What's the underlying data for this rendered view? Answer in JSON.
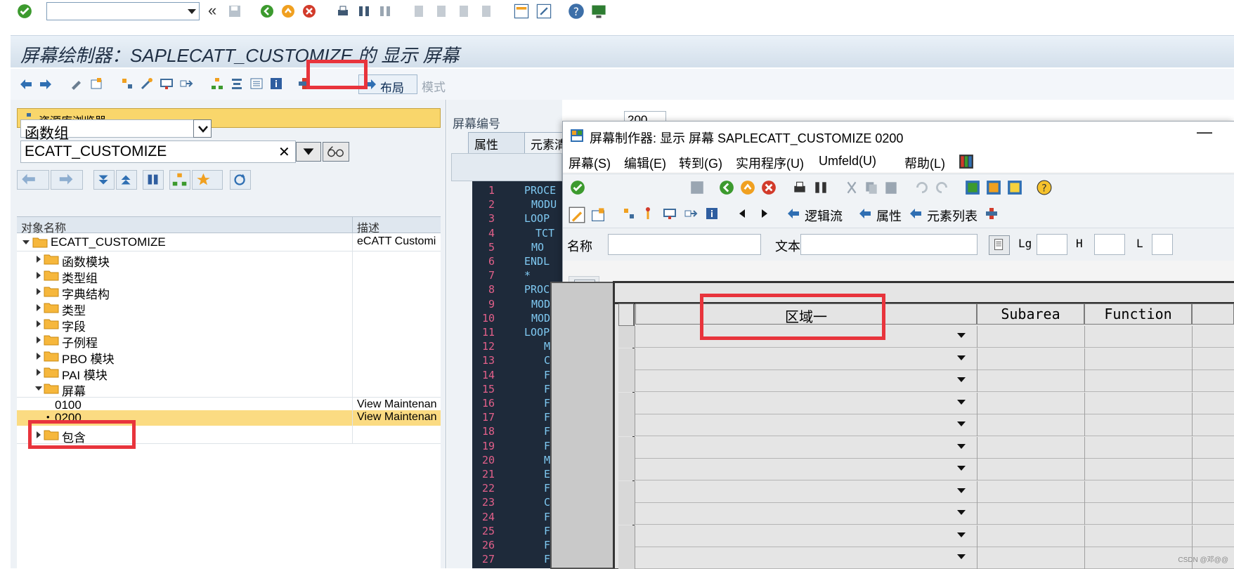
{
  "window": {
    "title": "屏幕绘制器：SAPLECATT_CUSTOMIZE 的 显示 屏幕"
  },
  "app_toolbar": {
    "layout_label": "布局",
    "mode_label": "模式"
  },
  "repository": {
    "header": "资源库浏览器",
    "object_type": "函数组",
    "object_name": "ECATT_CUSTOMIZE",
    "close_symbol": "✕"
  },
  "tree": {
    "col_object": "对象名称",
    "col_desc": "描述",
    "root": {
      "name": "ECATT_CUSTOMIZE",
      "desc": "eCATT Customi"
    },
    "nodes": [
      "函数模块",
      "类型组",
      "字典结构",
      "类型",
      "字段",
      "子例程",
      "PBO 模块",
      "PAI 模块"
    ],
    "screens_node": "屏幕",
    "screens": [
      {
        "name": "0100",
        "desc": "View Maintenan"
      },
      {
        "name": "0200",
        "desc": "View Maintenan"
      }
    ],
    "includes_node": "包含"
  },
  "screen_attrs": {
    "label": "屏幕编号",
    "value": "200",
    "tabs": [
      "属性",
      "元素清"
    ]
  },
  "code": {
    "lines": [
      "1",
      "2",
      "3",
      "4",
      "5",
      "6",
      "7",
      "8",
      "9",
      "10",
      "11",
      "12",
      "13",
      "14",
      "15",
      "16",
      "17",
      "18",
      "19",
      "20",
      "21",
      "22",
      "23",
      "24",
      "25",
      "26",
      "27"
    ],
    "text": [
      "PROCE",
      "MODU",
      "LOOP",
      "TCT",
      "MO",
      "ENDL",
      "*",
      "PROCE",
      "MODU",
      "MODU",
      "LOOP",
      "MO",
      "CH",
      "F",
      "F",
      "F",
      "F",
      "F",
      "F",
      "M",
      "EN",
      "FI",
      "CH",
      "F",
      "F",
      "F",
      "F"
    ]
  },
  "dialog": {
    "title": "屏幕制作器:  显示 屏幕 SAPLECATT_CUSTOMIZE 0200",
    "minimize": "—",
    "menu": [
      "屏幕(S)",
      "编辑(E)",
      "转到(G)",
      "实用程序(U)",
      "Umfeld(U)",
      "帮助(L)"
    ],
    "toolbar2": {
      "logic_flow": "逻辑流",
      "attributes": "属性",
      "element_list": "元素列表"
    },
    "fields": {
      "name_label": "名称",
      "text_label": "文本",
      "lg_label": "Lg",
      "h_label": "H",
      "l_label": "L"
    },
    "table": {
      "columns": [
        "区域一",
        "Subarea",
        "Function"
      ],
      "row_count": 11
    }
  },
  "footer": {
    "watermark": "CSDN @邓@@"
  },
  "colors": {
    "highlight_red": "#e8343c",
    "selection_yellow": "#fbdb82",
    "code_bg": "#1e2a3a"
  }
}
